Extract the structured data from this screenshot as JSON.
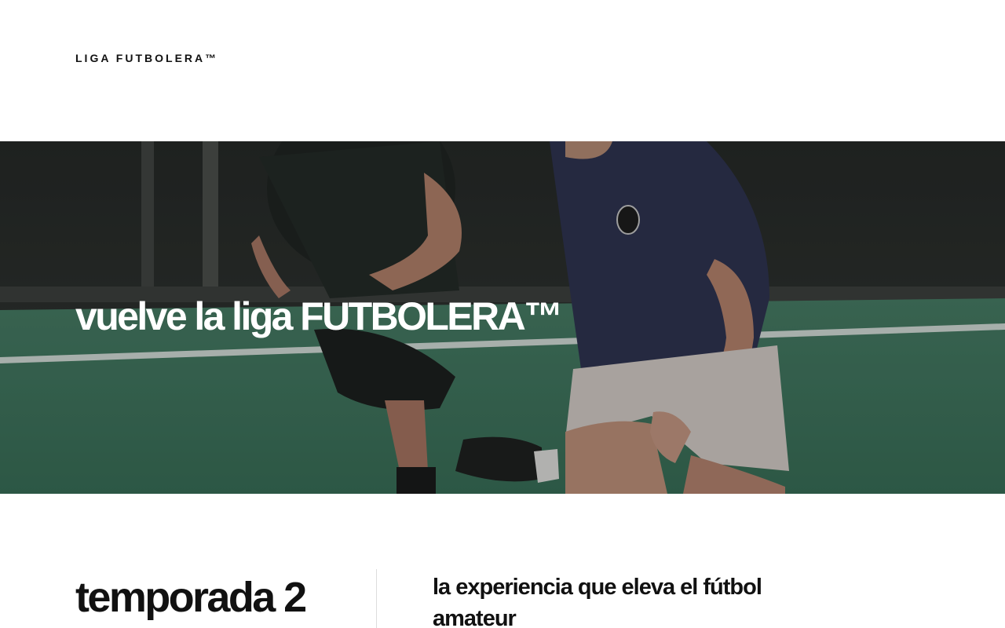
{
  "header": {
    "brand": "LIGA FUTBOLERA™"
  },
  "hero": {
    "title": "vuelve la liga FUTBOLERA™",
    "image_description_icon": "soccer-players-photo"
  },
  "season": {
    "title": "temporada 2",
    "tagline": "la experiencia que eleva el fútbol amateur"
  },
  "colors": {
    "text": "#111111",
    "background": "#ffffff",
    "hero_text": "#ffffff",
    "field_green": "#2f6b4f"
  }
}
